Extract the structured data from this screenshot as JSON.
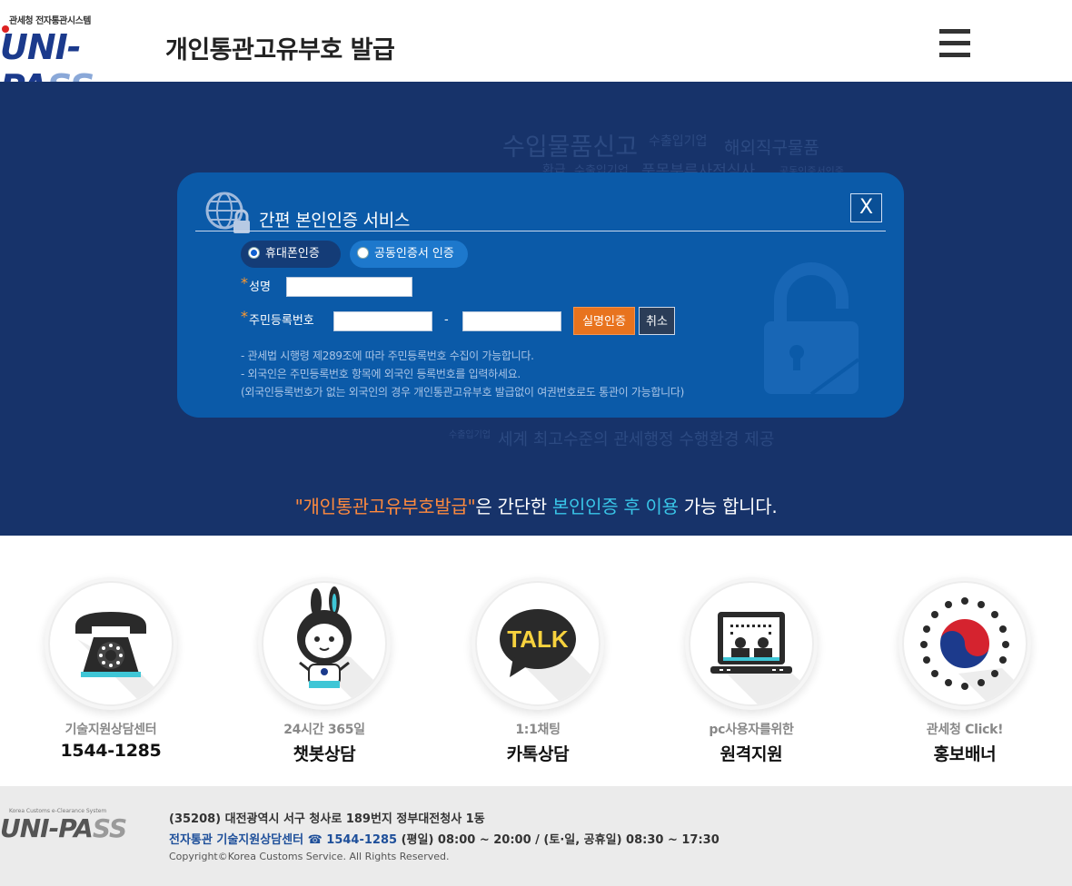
{
  "header": {
    "logo_tag": "관세청 전자통관시스템",
    "logo_text": "UNI-PA",
    "logo_text_accent": "SS",
    "title": "개인통관고유부호 발급",
    "menu_icon": "hamburger-menu-icon"
  },
  "hero": {
    "bg_texts": [
      "수입물품신고",
      "수출입기업",
      "해외직구물품",
      "환급",
      "수출입기업",
      "품목분류사전심사",
      "공동인증서인증",
      "세계 최고수준의 관세행정 수행환경 제공",
      "수출입기업"
    ],
    "message_quote": "\"개인통관고유부호발급\"",
    "message_mid": "은 간단한 ",
    "message_highlight": "본인인증 후 이용",
    "message_end": " 가능 합니다."
  },
  "modal": {
    "title": "간편 본인인증 서비스",
    "close_label": "X",
    "tabs": [
      {
        "label": "휴대폰인증",
        "selected": true
      },
      {
        "label": "공동인증서 인증",
        "selected": false
      }
    ],
    "name_label": "성명",
    "name_value": "",
    "rrn_label": "주민등록번호",
    "rrn_front_value": "",
    "rrn_dash": "-",
    "rrn_back_value": "",
    "verify_button": "실명인증",
    "cancel_button": "취소",
    "notes": [
      "- 관세법 시행령 제289조에 따라 주민등록번호 수집이 가능합니다.",
      "- 외국인은 주민등록번호 항목에 외국인 등록번호를 입력하세요.",
      " (외국인등록번호가 없는 외국인의 경우 개인통관고유부호 발급없이 여권번호로도 통관이 가능합니다)"
    ]
  },
  "services": [
    {
      "sub": "기술지원상담센터",
      "main": "1544-1285",
      "icon": "telephone-icon"
    },
    {
      "sub": "24시간 365일",
      "main": "챗봇상담",
      "icon": "chatbot-mascot-icon"
    },
    {
      "sub": "1:1채팅",
      "main": "카톡상담",
      "icon": "kakaotalk-icon",
      "icon_text": "TALK"
    },
    {
      "sub": "pc사용자를위한",
      "main": "원격지원",
      "icon": "remote-support-icon"
    },
    {
      "sub": "관세청 Click!",
      "main": "홍보배너",
      "icon": "government-emblem-icon"
    }
  ],
  "footer": {
    "logo_tag": "Korea Customs e-Clearance System",
    "logo_text": "UNI-PA",
    "logo_text_accent": "SS",
    "address": "(35208) 대전광역시 서구 청사로 189번지 정부대전청사 1동",
    "center_label": "전자통관 기술지원상담센터 ☎ 1544-1285",
    "hours": " (평일) 08:00 ~ 20:00 / (토·일, 공휴일) 08:30 ~ 17:30",
    "copyright": "Copyright©Korea Customs Service. All Rights Reserved."
  },
  "colors": {
    "hero_bg": "#17336a",
    "modal_bg": "#0b5aa8",
    "accent_orange": "#e8731e",
    "highlight_cyan": "#39c6e8"
  }
}
